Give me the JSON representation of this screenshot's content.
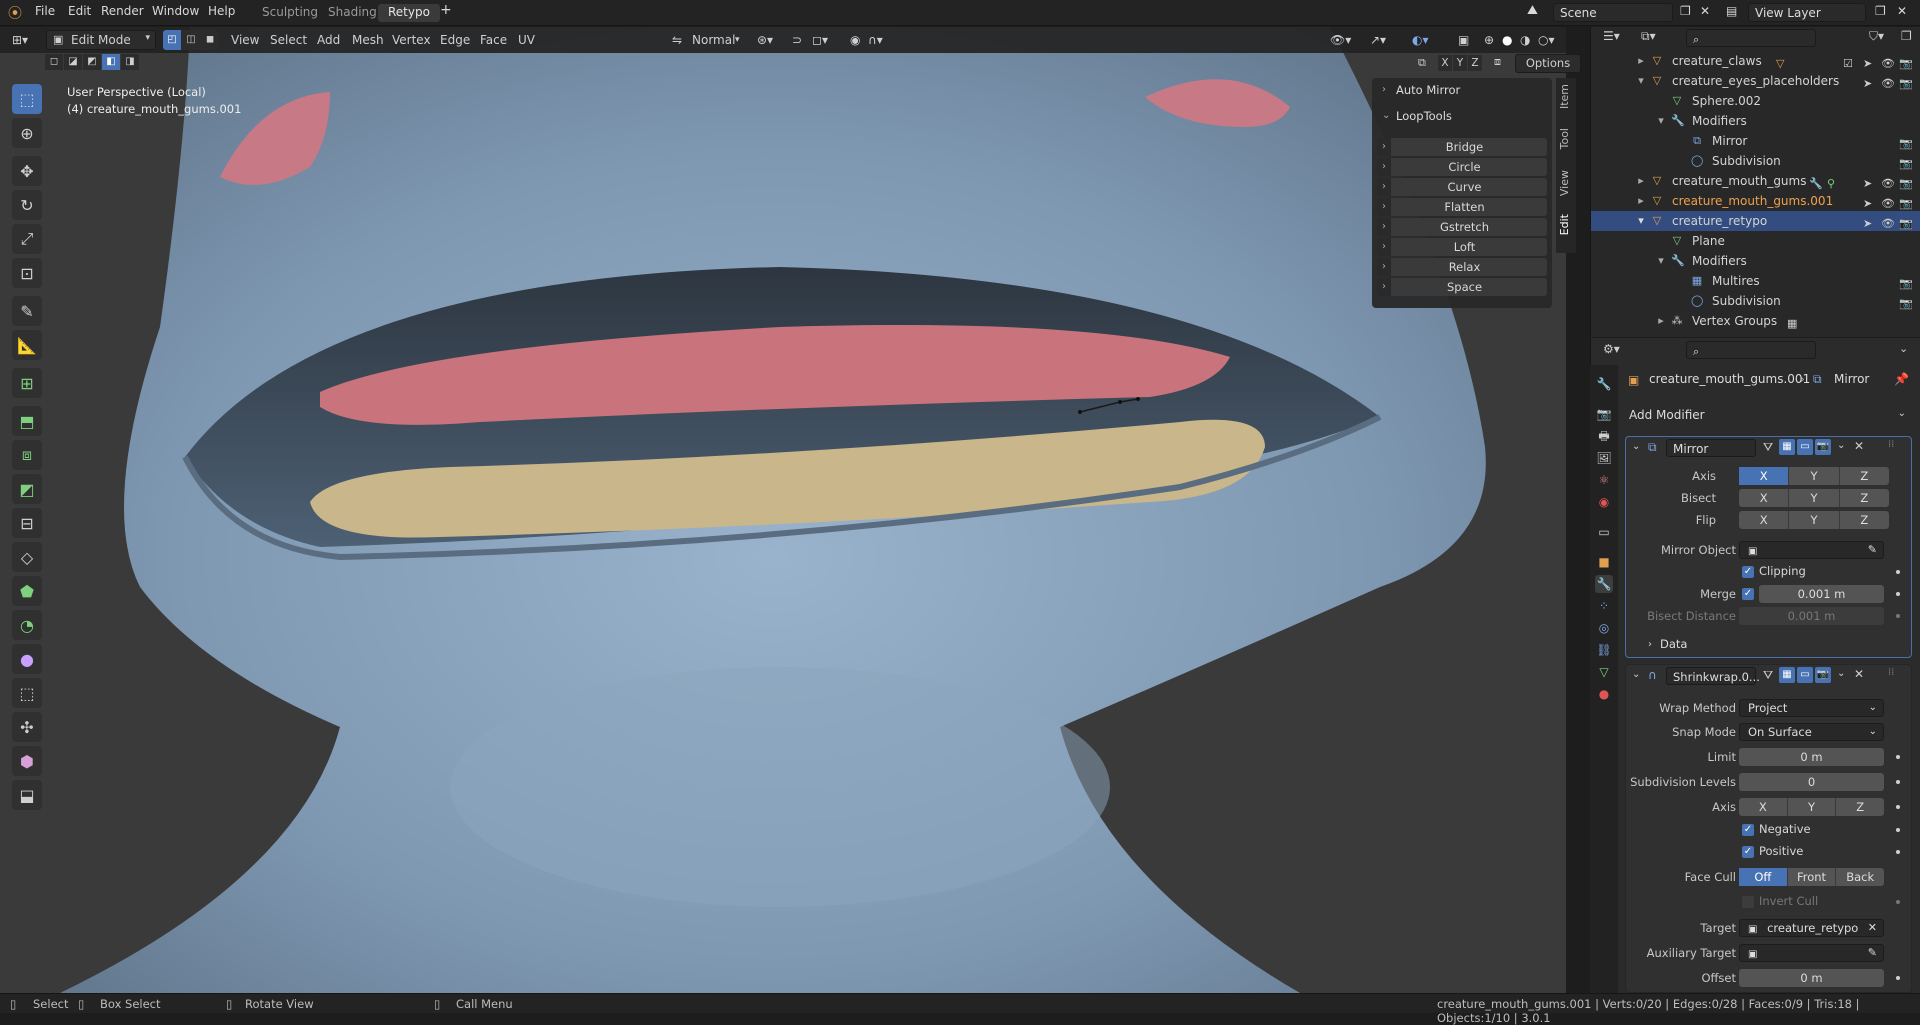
{
  "top_menu": {
    "file": "File",
    "edit": "Edit",
    "render": "Render",
    "window": "Window",
    "help": "Help",
    "workspaces": [
      "Sculpting",
      "Shading",
      "Retypo"
    ],
    "active_workspace": "Retypo",
    "add_tab": "+",
    "scene": "Scene",
    "view_layer": "View Layer"
  },
  "viewport_header": {
    "mode": "Edit Mode",
    "menus": [
      "View",
      "Select",
      "Add",
      "Mesh",
      "Vertex",
      "Edge",
      "Face",
      "UV"
    ],
    "orientation": "Normal",
    "options": "Options",
    "axes": [
      "X",
      "Y",
      "Z"
    ]
  },
  "viewport": {
    "perspective": "User Perspective (Local)",
    "object": "(4) creature_mouth_gums.001",
    "colors": {
      "skin": "#8aa4bd",
      "gums": "#c9747c",
      "teeth": "#c9b68a",
      "background": "#3a3a3a"
    }
  },
  "npanel": {
    "auto_mirror": "Auto Mirror",
    "looptools": "LoopTools",
    "buttons": [
      "Bridge",
      "Circle",
      "Curve",
      "Flatten",
      "Gstretch",
      "Loft",
      "Relax",
      "Space"
    ],
    "tabs": [
      "Item",
      "Tool",
      "View",
      "Edit"
    ]
  },
  "outliner": {
    "rows": [
      {
        "label": "creature_claws"
      },
      {
        "label": "creature_eyes_placeholders"
      },
      {
        "label": "Sphere.002"
      },
      {
        "label": "Modifiers"
      },
      {
        "label": "Mirror"
      },
      {
        "label": "Subdivision"
      },
      {
        "label": "creature_mouth_gums"
      },
      {
        "label": "creature_mouth_gums.001"
      },
      {
        "label": "creature_retypo"
      },
      {
        "label": "Plane"
      },
      {
        "label": "Modifiers"
      },
      {
        "label": "Multires"
      },
      {
        "label": "Subdivision"
      },
      {
        "label": "Vertex Groups"
      }
    ]
  },
  "properties": {
    "breadcrumb_object": "creature_mouth_gums.001",
    "breadcrumb_modifier": "Mirror",
    "add_modifier": "Add Modifier",
    "mirror": {
      "name": "Mirror",
      "axis_label": "Axis",
      "bisect_label": "Bisect",
      "flip_label": "Flip",
      "xyz": [
        "X",
        "Y",
        "Z"
      ],
      "mirror_object_label": "Mirror Object",
      "clipping": "Clipping",
      "merge_label": "Merge",
      "merge_value": "0.001 m",
      "bisect_distance_label": "Bisect Distance",
      "bisect_distance_value": "0.001 m",
      "data": "Data"
    },
    "shrinkwrap": {
      "name": "Shrinkwrap.0...",
      "wrap_method_label": "Wrap Method",
      "wrap_method": "Project",
      "snap_mode_label": "Snap Mode",
      "snap_mode": "On Surface",
      "limit_label": "Limit",
      "limit": "0 m",
      "subdiv_label": "Subdivision Levels",
      "subdiv": "0",
      "axis_label": "Axis",
      "negative": "Negative",
      "positive": "Positive",
      "face_cull_label": "Face Cull",
      "face_cull": [
        "Off",
        "Front",
        "Back"
      ],
      "invert_cull": "Invert Cull",
      "target_label": "Target",
      "target": "creature_retypo",
      "aux_target_label": "Auxiliary Target",
      "offset_label": "Offset",
      "offset": "0 m"
    }
  },
  "statusbar": {
    "select": "Select",
    "box_select": "Box Select",
    "rotate_view": "Rotate View",
    "call_menu": "Call Menu",
    "stats": "creature_mouth_gums.001 | Verts:0/20 | Edges:0/28 | Faces:0/9 | Tris:18 | Objects:1/10 | 3.0.1"
  }
}
